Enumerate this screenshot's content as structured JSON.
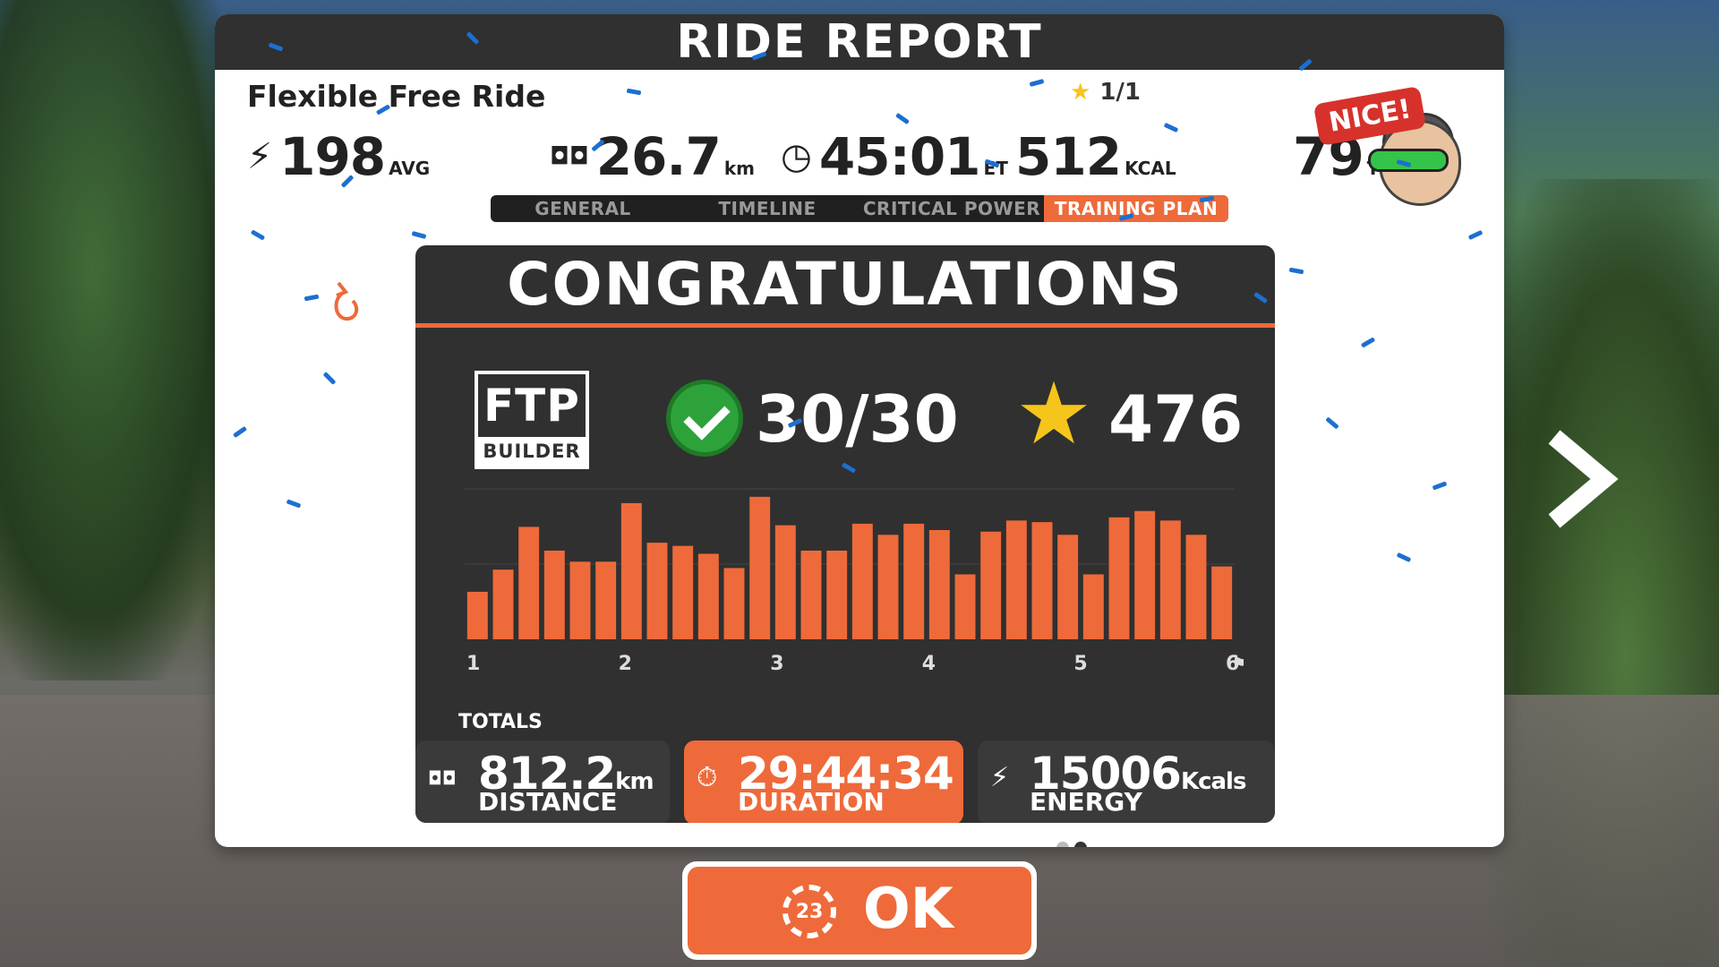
{
  "header": {
    "title": "RIDE REPORT"
  },
  "ride": {
    "name": "Flexible Free Ride",
    "progress": "1/1",
    "stats": [
      {
        "icon": "power-icon",
        "value": "198",
        "unit": "AVG"
      },
      {
        "icon": "odometer-icon",
        "value": "26.7",
        "unit": "km"
      },
      {
        "icon": "clock-icon",
        "value": "45:01",
        "unit": "ET"
      },
      {
        "icon": "none",
        "value": "512",
        "unit": "KCAL"
      },
      {
        "icon": "none",
        "value": "79",
        "unit": "TSS"
      }
    ]
  },
  "badge": {
    "text": "NICE!"
  },
  "tabs": [
    {
      "label": "GENERAL"
    },
    {
      "label": "TIMELINE"
    },
    {
      "label": "CRITICAL POWER"
    },
    {
      "label": "TRAINING PLAN",
      "active": true
    }
  ],
  "card": {
    "title": "CONGRATULATIONS",
    "logo_big": "FTP",
    "logo_small": "BUILDER",
    "completed": "30/30",
    "points": "476"
  },
  "chart_data": {
    "type": "bar",
    "color": "#ee6a3a",
    "x_tick_labels": [
      "1",
      "2",
      "3",
      "4",
      "5",
      "6"
    ],
    "values": [
      30,
      44,
      71,
      56,
      49,
      49,
      86,
      61,
      59,
      54,
      45,
      90,
      72,
      56,
      56,
      73,
      66,
      73,
      69,
      41,
      68,
      75,
      74,
      66,
      41,
      77,
      81,
      75,
      66,
      46
    ],
    "ylim": [
      0,
      95
    ],
    "grid": true
  },
  "totals": {
    "label": "TOTALS",
    "distance": {
      "value": "812.2",
      "unit": "km",
      "label": "DISTANCE"
    },
    "duration": {
      "value": "29:44:34",
      "label": "DURATION"
    },
    "energy": {
      "value": "15006",
      "unit": "Kcals",
      "label": "ENERGY"
    }
  },
  "pagination": {
    "pages": 2,
    "current": 2
  },
  "ok_button": {
    "label": "OK",
    "countdown": "23"
  }
}
